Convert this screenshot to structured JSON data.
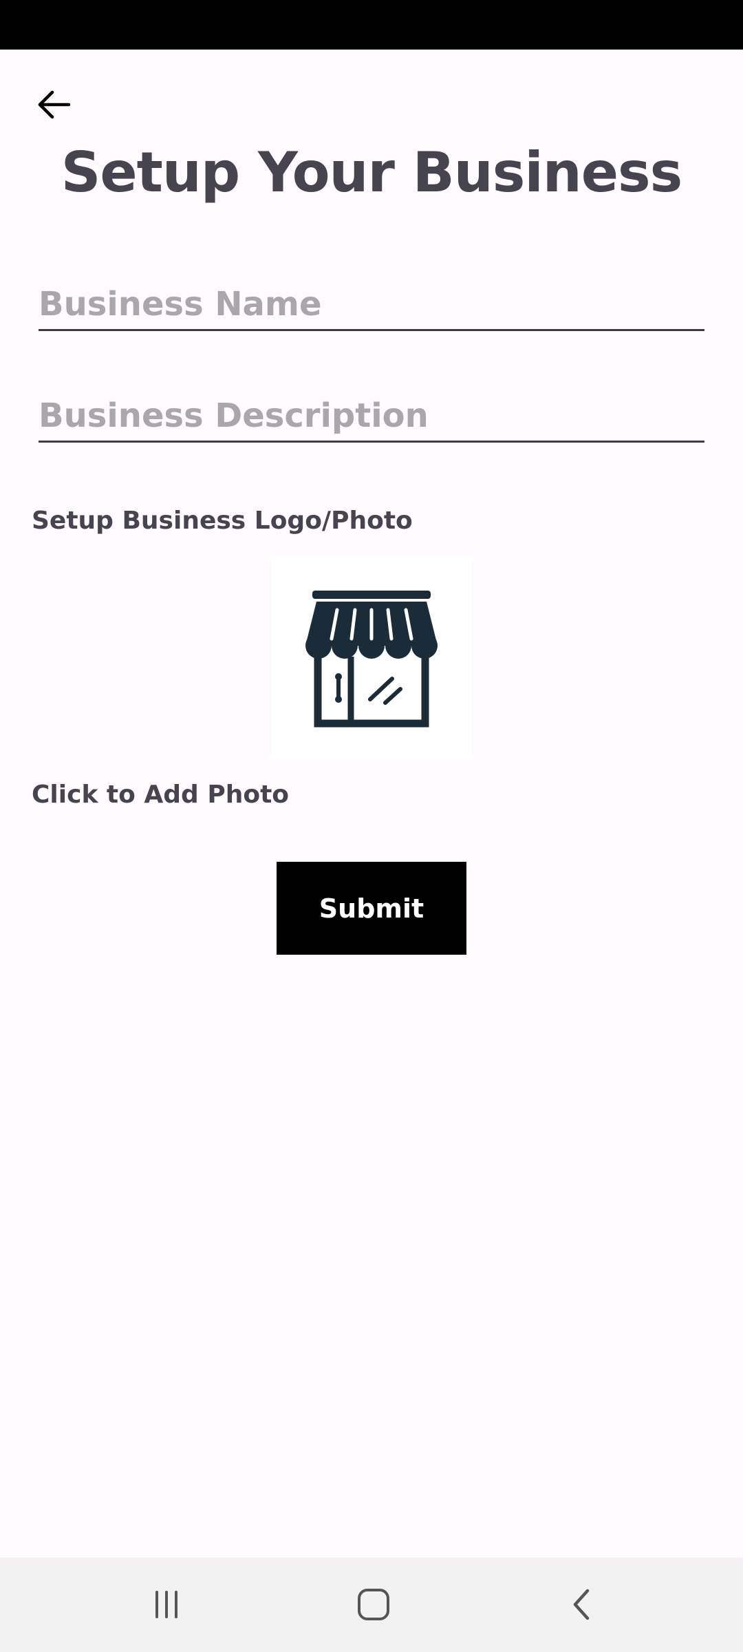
{
  "header": {
    "title": "Setup Your Business",
    "back_icon": "arrow-left-icon"
  },
  "form": {
    "business_name": {
      "value": "",
      "placeholder": "Business Name"
    },
    "business_description": {
      "value": "",
      "placeholder": "Business Description"
    },
    "logo_section_label": "Setup Business Logo/Photo",
    "photo_icon": "storefront-icon",
    "add_photo_label": "Click to Add Photo",
    "submit_label": "Submit"
  },
  "colors": {
    "background": "#fefafd",
    "title_text": "#46444f",
    "placeholder_text": "#a9a7ab",
    "submit_bg": "#000000",
    "icon_dark": "#1b2b38"
  },
  "system_nav": {
    "recents_icon": "recents-icon",
    "home_icon": "home-icon",
    "back_icon": "nav-back-icon"
  }
}
